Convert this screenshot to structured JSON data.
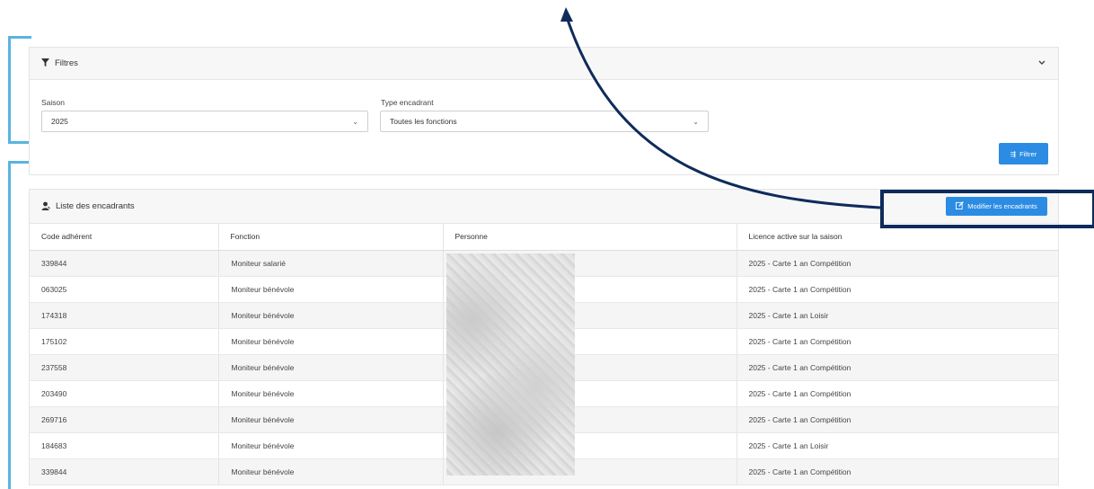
{
  "filters": {
    "title": "Filtres",
    "saison_label": "Saison",
    "saison_value": "2025",
    "type_label": "Type encadrant",
    "type_value": "Toutes les fonctions",
    "filter_button": "Filtrer"
  },
  "list": {
    "title": "Liste des encadrants",
    "edit_button": "Modifier les encadrants",
    "columns": [
      "Code adhérent",
      "Fonction",
      "Personne",
      "Licence active sur la saison"
    ],
    "rows": [
      {
        "code": "339844",
        "fonction": "Moniteur salarié",
        "licence": "2025 - Carte 1 an Compétition"
      },
      {
        "code": "063025",
        "fonction": "Moniteur bénévole",
        "licence": "2025 - Carte 1 an Compétition"
      },
      {
        "code": "174318",
        "fonction": "Moniteur bénévole",
        "licence": "2025 - Carte 1 an Loisir"
      },
      {
        "code": "175102",
        "fonction": "Moniteur bénévole",
        "licence": "2025 - Carte 1 an Compétition"
      },
      {
        "code": "237558",
        "fonction": "Moniteur bénévole",
        "licence": "2025 - Carte 1 an Compétition"
      },
      {
        "code": "203490",
        "fonction": "Moniteur bénévole",
        "licence": "2025 - Carte 1 an Compétition"
      },
      {
        "code": "269716",
        "fonction": "Moniteur bénévole",
        "licence": "2025 - Carte 1 an Compétition"
      },
      {
        "code": "184683",
        "fonction": "Moniteur bénévole",
        "licence": "2025 - Carte 1 an Loisir"
      },
      {
        "code": "339844",
        "fonction": "Moniteur bénévole",
        "licence": "2025 - Carte 1 an Compétition"
      }
    ]
  },
  "colors": {
    "accent": "#2c8ce3",
    "annotation_bracket": "#5ab4e0",
    "annotation_arrow": "#0f2b5b"
  },
  "icons": {
    "filter": "funnel-icon",
    "chevron": "chevron-down-icon",
    "list": "user-icon",
    "edit": "edit-icon"
  }
}
